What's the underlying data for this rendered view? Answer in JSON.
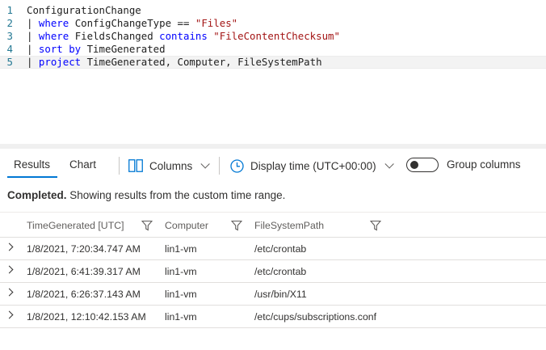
{
  "editor": {
    "lines": [
      {
        "num": "1",
        "tokens": [
          {
            "t": "ConfigurationChange",
            "c": "ident"
          }
        ]
      },
      {
        "num": "2",
        "tokens": [
          {
            "t": "| ",
            "c": "pipe"
          },
          {
            "t": "where",
            "c": "kw"
          },
          {
            "t": " ConfigChangeType == ",
            "c": "op"
          },
          {
            "t": "\"Files\"",
            "c": "str"
          }
        ]
      },
      {
        "num": "3",
        "tokens": [
          {
            "t": "| ",
            "c": "pipe"
          },
          {
            "t": "where",
            "c": "kw"
          },
          {
            "t": " FieldsChanged ",
            "c": "op"
          },
          {
            "t": "contains",
            "c": "kw"
          },
          {
            "t": " ",
            "c": "op"
          },
          {
            "t": "\"FileContentChecksum\"",
            "c": "str"
          }
        ]
      },
      {
        "num": "4",
        "tokens": [
          {
            "t": "| ",
            "c": "pipe"
          },
          {
            "t": "sort by",
            "c": "kw"
          },
          {
            "t": " TimeGenerated",
            "c": "op"
          }
        ]
      },
      {
        "num": "5",
        "tokens": [
          {
            "t": "| ",
            "c": "pipe"
          },
          {
            "t": "project",
            "c": "kw"
          },
          {
            "t": " TimeGenerated, Computer, FileSystemPath",
            "c": "op"
          }
        ]
      }
    ]
  },
  "toolbar": {
    "tab_results": "Results",
    "tab_chart": "Chart",
    "columns_label": "Columns",
    "display_time_label": "Display time (UTC+00:00)",
    "group_columns_label": "Group columns",
    "group_columns_on": false
  },
  "status": {
    "bold": "Completed.",
    "text": " Showing results from the custom time range."
  },
  "table": {
    "headers": [
      "TimeGenerated [UTC]",
      "Computer",
      "FileSystemPath"
    ],
    "rows": [
      [
        "1/8/2021, 7:20:34.747 AM",
        "lin1-vm",
        "/etc/crontab"
      ],
      [
        "1/8/2021, 6:41:39.317 AM",
        "lin1-vm",
        "/etc/crontab"
      ],
      [
        "1/8/2021, 6:26:37.143 AM",
        "lin1-vm",
        "/usr/bin/X11"
      ],
      [
        "1/8/2021, 12:10:42.153 AM",
        "lin1-vm",
        "/etc/cups/subscriptions.conf"
      ]
    ]
  },
  "colors": {
    "accent": "#0078d4",
    "keyword": "#0000ff",
    "string": "#a31515",
    "line_number": "#237893"
  }
}
